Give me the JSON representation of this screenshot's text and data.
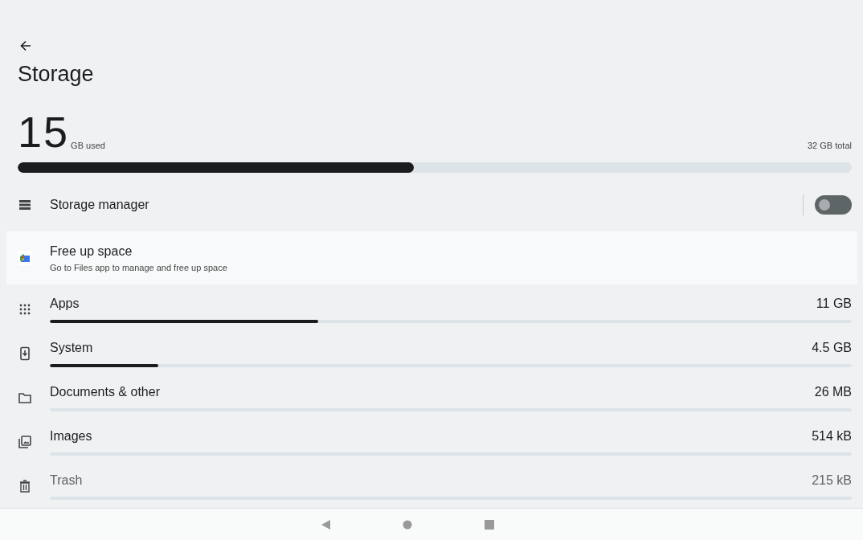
{
  "title": "Storage",
  "usage": {
    "used": "15",
    "used_unit": "GB used",
    "total": "32 GB total",
    "level": 0.475
  },
  "storage_manager": {
    "label": "Storage manager",
    "on": false
  },
  "free_up": {
    "title": "Free up space",
    "subtitle": "Go to Files app to manage and free up space"
  },
  "categories": [
    {
      "kind": "apps",
      "label": "Apps",
      "size": "11 GB",
      "level": 0.335
    },
    {
      "kind": "system",
      "label": "System",
      "size": "4.5 GB",
      "level": 0.135
    },
    {
      "kind": "documents",
      "label": "Documents & other",
      "size": "26 MB",
      "level": 0
    },
    {
      "kind": "images",
      "label": "Images",
      "size": "514 kB",
      "level": 0
    },
    {
      "kind": "trash",
      "label": "Trash",
      "size": "215 kB",
      "level": 0
    }
  ]
}
